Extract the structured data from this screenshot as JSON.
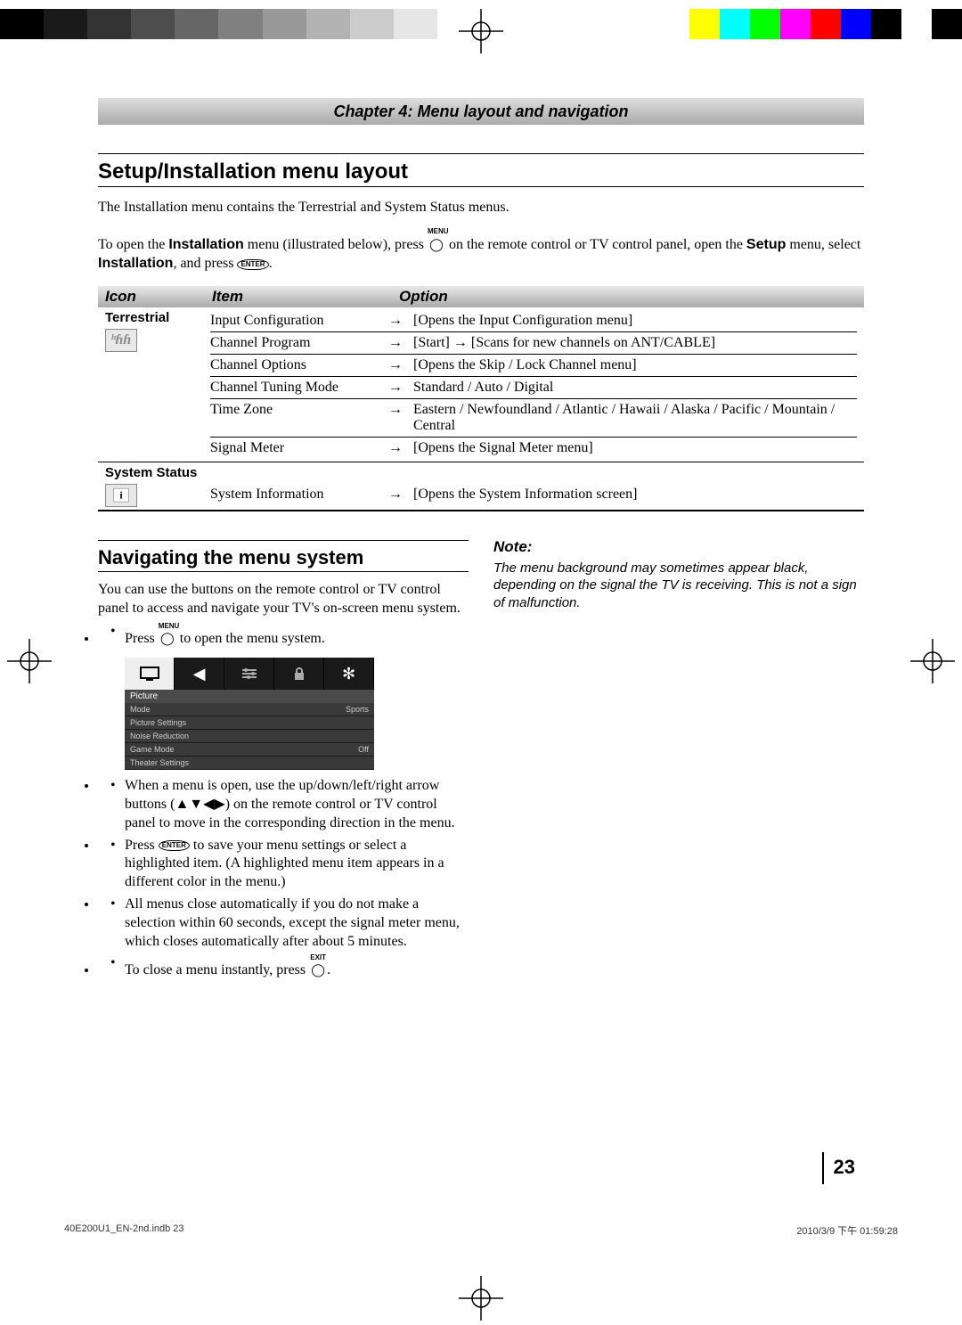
{
  "chapter": "Chapter 4: Menu layout and navigation",
  "section1": "Setup/Installation menu layout",
  "intro1": "The Installation menu contains the Terrestrial and System Status menus.",
  "intro2a": "To open the ",
  "intro2b_bold": "Installation",
  "intro2c": " menu (illustrated below), press ",
  "intro2d": " on the remote control or TV control panel, open the ",
  "intro2e_bold": "Setup",
  "intro2f": " menu, select ",
  "intro2g_bold": "Installation",
  "intro2h": ", and press ",
  "intro2i": ".",
  "menu_label": "MENU",
  "exit_label": "EXIT",
  "enter_label": "ENTER",
  "tab": {
    "h_icon": "Icon",
    "h_item": "Item",
    "h_option": "Option",
    "terrestrial_label": "Terrestrial",
    "system_status_label": "System Status",
    "rows": [
      {
        "item": "Input Configuration",
        "option": "[Opens the Input Configuration menu]"
      },
      {
        "item": "Channel Program",
        "option": "[Start] → [Scans for new channels on ANT/CABLE]"
      },
      {
        "item": "Channel Options",
        "option": "[Opens the Skip / Lock Channel menu]"
      },
      {
        "item": "Channel Tuning Mode",
        "option": "Standard / Auto / Digital"
      },
      {
        "item": "Time Zone",
        "option": "Eastern / Newfoundland / Atlantic / Hawaii / Alaska / Pacific / Mountain / Central"
      },
      {
        "item": "Signal Meter",
        "option": "[Opens the Signal Meter menu]"
      }
    ],
    "sys_row": {
      "item": "System Information",
      "option": "[Opens the System Information screen]"
    }
  },
  "arrow": "→",
  "section2": "Navigating the menu system",
  "nav_p": "You can use the buttons on the remote control or TV control panel to access and navigate your TV's on-screen menu system.",
  "bul1a": "Press ",
  "bul1b": " to open the menu system.",
  "bul2": "When a menu is open, use the up/down/left/right arrow buttons (▲▼◀▶) on the remote control or TV control panel to move in the corresponding direction in the menu.",
  "bul3a": "Press ",
  "bul3b": " to save your menu settings or select a highlighted item. (A highlighted menu item appears in a different color in the menu.)",
  "bul4": "All menus close automatically if you do not make a selection within 60 seconds, except the signal meter menu, which closes automatically after about 5 minutes.",
  "bul5a": "To close a menu instantly, press ",
  "bul5b": ".",
  "osd": {
    "label": "Picture",
    "rows": [
      {
        "l": "Mode",
        "r": "Sports"
      },
      {
        "l": "Picture Settings",
        "r": ""
      },
      {
        "l": "Noise Reduction",
        "r": ""
      },
      {
        "l": "Game Mode",
        "r": "Off"
      },
      {
        "l": "Theater Settings",
        "r": ""
      }
    ]
  },
  "note_head": "Note:",
  "note_body": "The menu background may sometimes appear black, depending on the signal the TV is receiving. This is not a sign of malfunction.",
  "page": "23",
  "footer_left": "40E200U1_EN-2nd.indb   23",
  "footer_right": "2010/3/9   下午 01:59:28",
  "colorbars_left": [
    "#000",
    "#1a1a1a",
    "#333",
    "#4d4d4d",
    "#666",
    "#808080",
    "#999",
    "#b3b3b3",
    "#ccc",
    "#e6e6e6",
    "#fff"
  ],
  "colorbars_right": [
    "#fff",
    "#ff0",
    "#0ff",
    "#0f0",
    "#f0f",
    "#f00",
    "#00f",
    "#000",
    "#fff",
    "#000"
  ]
}
